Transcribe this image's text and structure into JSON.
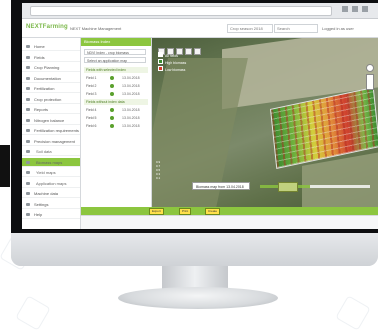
{
  "app": {
    "logo": "NEXTFarming",
    "title": "NEXT Machine Management",
    "season": "Crop season 2018",
    "search": "Search",
    "user": "Logged in as user"
  },
  "sidebar": {
    "items": [
      {
        "label": "Home"
      },
      {
        "label": "Fields"
      },
      {
        "label": "Crop Planning"
      },
      {
        "label": "Documentation"
      },
      {
        "label": "Fertilization"
      },
      {
        "label": "Crop protection"
      },
      {
        "label": "Reports"
      },
      {
        "label": "Nitrogen balance"
      },
      {
        "label": "Fertilization requirements"
      },
      {
        "label": "Precision management"
      },
      {
        "label": "Soil data"
      },
      {
        "label": "Biomass maps"
      },
      {
        "label": "Yield maps"
      },
      {
        "label": "Application maps"
      },
      {
        "label": "Machine data"
      },
      {
        "label": "Settings"
      },
      {
        "label": "Help"
      }
    ]
  },
  "panel": {
    "title": "Biomass Index",
    "select1": "NDVI Index - crop biomass",
    "select2": "Select an application map",
    "section1": "Fields with selected index",
    "rows1": [
      {
        "label": "Field 1",
        "value": "13.04.2018"
      },
      {
        "label": "Field 2",
        "value": "13.04.2018"
      },
      {
        "label": "Field 3",
        "value": "13.04.2018"
      }
    ],
    "section2": "Fields without index data",
    "rows2": [
      {
        "label": "Field 4",
        "value": "13.04.2018"
      },
      {
        "label": "Field 5",
        "value": "13.04.2018"
      },
      {
        "label": "Field 6",
        "value": "13.04.2018"
      }
    ]
  },
  "map": {
    "legend": [
      {
        "label": "All fields",
        "color": "#ffffff"
      },
      {
        "label": "High biomass",
        "color": "#3a8c2e"
      },
      {
        "label": "Low biomass",
        "color": "#d43c2c"
      }
    ],
    "date": "Biomass map from 13.04.2018",
    "scale": [
      "0.9",
      "0.7",
      "0.5",
      "0.3",
      "0.1"
    ],
    "timeline_progress": 0.45
  },
  "footer": {
    "buttons": [
      "Export",
      "Print",
      "Create"
    ]
  }
}
